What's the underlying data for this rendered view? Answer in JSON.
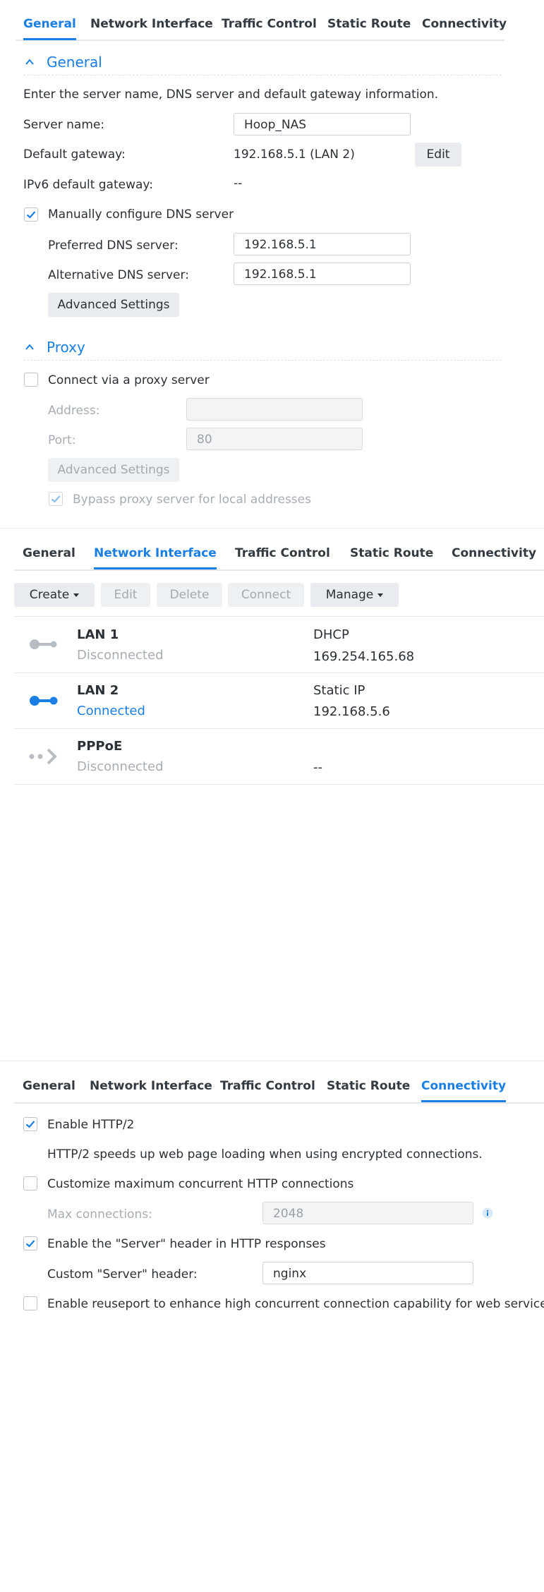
{
  "panel1": {
    "tabs": [
      "General",
      "Network Interface",
      "Traffic Control",
      "Static Route",
      "Connectivity"
    ],
    "general_section": {
      "title": "General",
      "description": "Enter the server name, DNS server and default gateway information.",
      "server_name_label": "Server name:",
      "server_name_value": "Hoop_NAS",
      "default_gateway_label": "Default gateway:",
      "default_gateway_value": "192.168.5.1 (LAN 2)",
      "edit_button": "Edit",
      "ipv6_gateway_label": "IPv6 default gateway:",
      "ipv6_gateway_value": "--",
      "manual_dns_label": "Manually configure DNS server",
      "manual_dns_checked": true,
      "preferred_dns_label": "Preferred DNS server:",
      "preferred_dns_value": "192.168.5.1",
      "alternative_dns_label": "Alternative DNS server:",
      "alternative_dns_value": "192.168.5.1",
      "advanced_button": "Advanced Settings"
    },
    "proxy_section": {
      "title": "Proxy",
      "connect_label": "Connect via a proxy server",
      "connect_checked": false,
      "address_label": "Address:",
      "address_value": "",
      "port_label": "Port:",
      "port_value": "80",
      "advanced_button": "Advanced Settings",
      "bypass_label": "Bypass proxy server for local addresses",
      "bypass_checked": true
    }
  },
  "panel2": {
    "tabs": [
      "General",
      "Network Interface",
      "Traffic Control",
      "Static Route",
      "Connectivity"
    ],
    "toolbar": {
      "create": "Create",
      "edit": "Edit",
      "delete": "Delete",
      "connect": "Connect",
      "manage": "Manage"
    },
    "interfaces": [
      {
        "name": "LAN 1",
        "status": "Disconnected",
        "type": "DHCP",
        "address": "169.254.165.68"
      },
      {
        "name": "LAN 2",
        "status": "Connected",
        "type": "Static IP",
        "address": "192.168.5.6"
      },
      {
        "name": "PPPoE",
        "status": "Disconnected",
        "type": "",
        "address": "--"
      }
    ]
  },
  "panel3": {
    "tabs": [
      "General",
      "Network Interface",
      "Traffic Control",
      "Static Route",
      "Connectivity"
    ],
    "enable_http2_label": "Enable HTTP/2",
    "enable_http2_checked": true,
    "http2_description": "HTTP/2 speeds up web page loading when using encrypted connections.",
    "customize_max_label": "Customize maximum concurrent HTTP connections",
    "customize_max_checked": false,
    "max_connections_label": "Max connections:",
    "max_connections_value": "2048",
    "server_header_label": "Enable the \"Server\" header in HTTP responses",
    "server_header_checked": true,
    "custom_header_label": "Custom \"Server\" header:",
    "custom_header_value": "nginx",
    "reuseport_label": "Enable reuseport to enhance high concurrent connection capability for web service",
    "reuseport_checked": false
  },
  "colors": {
    "accent": "#1a7ee3",
    "text": "#2b3036",
    "muted": "#a7adb4"
  }
}
